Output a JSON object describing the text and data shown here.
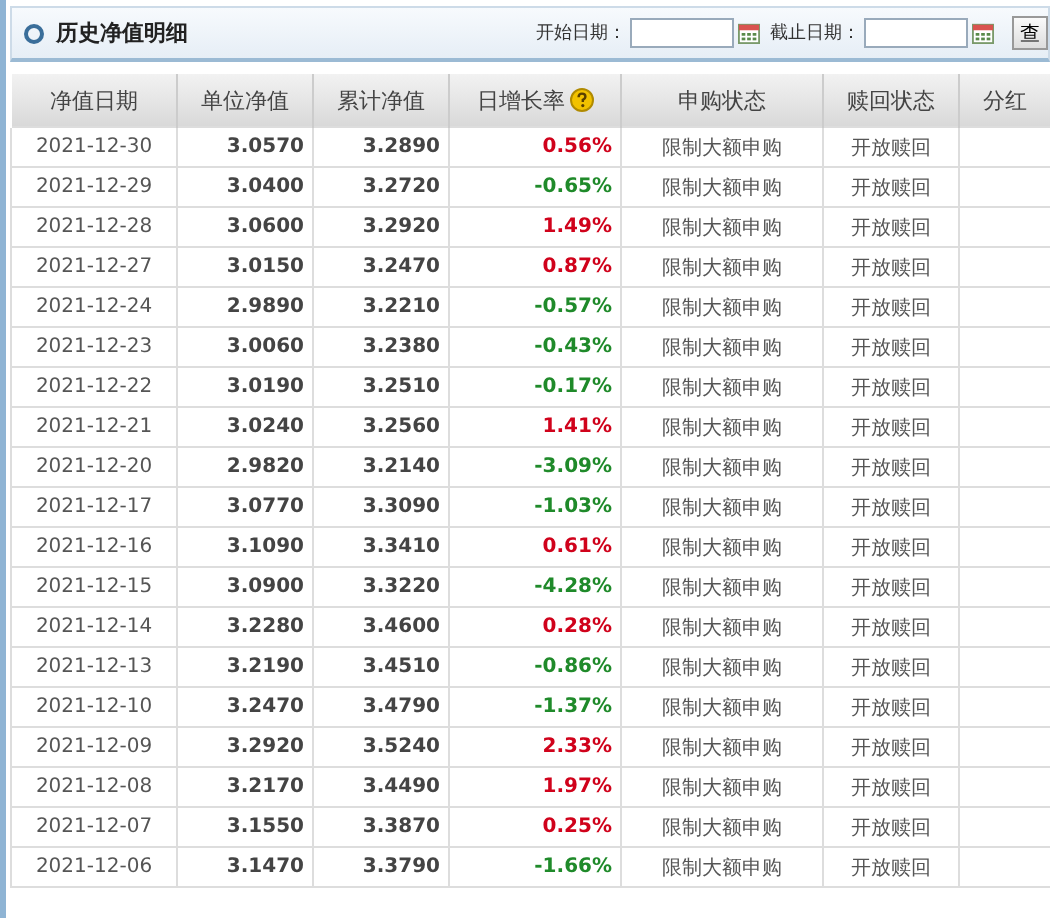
{
  "header": {
    "title": "历史净值明细",
    "start_label": "开始日期：",
    "end_label": "截止日期：",
    "query_button": "查"
  },
  "table": {
    "columns": [
      "净值日期",
      "单位净值",
      "累计净值",
      "日增长率",
      "申购状态",
      "赎回状态",
      "分红"
    ],
    "rows": [
      {
        "date": "2021-12-30",
        "nav": "3.0570",
        "acc": "3.2890",
        "change": "0.56%",
        "color": "#d0021b",
        "buy": "限制大额申购",
        "redeem": "开放赎回"
      },
      {
        "date": "2021-12-29",
        "nav": "3.0400",
        "acc": "3.2720",
        "change": "-0.65%",
        "color": "#1f8a2a",
        "buy": "限制大额申购",
        "redeem": "开放赎回"
      },
      {
        "date": "2021-12-28",
        "nav": "3.0600",
        "acc": "3.2920",
        "change": "1.49%",
        "color": "#d0021b",
        "buy": "限制大额申购",
        "redeem": "开放赎回"
      },
      {
        "date": "2021-12-27",
        "nav": "3.0150",
        "acc": "3.2470",
        "change": "0.87%",
        "color": "#d0021b",
        "buy": "限制大额申购",
        "redeem": "开放赎回"
      },
      {
        "date": "2021-12-24",
        "nav": "2.9890",
        "acc": "3.2210",
        "change": "-0.57%",
        "color": "#1f8a2a",
        "buy": "限制大额申购",
        "redeem": "开放赎回"
      },
      {
        "date": "2021-12-23",
        "nav": "3.0060",
        "acc": "3.2380",
        "change": "-0.43%",
        "color": "#1f8a2a",
        "buy": "限制大额申购",
        "redeem": "开放赎回"
      },
      {
        "date": "2021-12-22",
        "nav": "3.0190",
        "acc": "3.2510",
        "change": "-0.17%",
        "color": "#1f8a2a",
        "buy": "限制大额申购",
        "redeem": "开放赎回"
      },
      {
        "date": "2021-12-21",
        "nav": "3.0240",
        "acc": "3.2560",
        "change": "1.41%",
        "color": "#d0021b",
        "buy": "限制大额申购",
        "redeem": "开放赎回"
      },
      {
        "date": "2021-12-20",
        "nav": "2.9820",
        "acc": "3.2140",
        "change": "-3.09%",
        "color": "#1f8a2a",
        "buy": "限制大额申购",
        "redeem": "开放赎回"
      },
      {
        "date": "2021-12-17",
        "nav": "3.0770",
        "acc": "3.3090",
        "change": "-1.03%",
        "color": "#1f8a2a",
        "buy": "限制大额申购",
        "redeem": "开放赎回"
      },
      {
        "date": "2021-12-16",
        "nav": "3.1090",
        "acc": "3.3410",
        "change": "0.61%",
        "color": "#d0021b",
        "buy": "限制大额申购",
        "redeem": "开放赎回"
      },
      {
        "date": "2021-12-15",
        "nav": "3.0900",
        "acc": "3.3220",
        "change": "-4.28%",
        "color": "#1f8a2a",
        "buy": "限制大额申购",
        "redeem": "开放赎回"
      },
      {
        "date": "2021-12-14",
        "nav": "3.2280",
        "acc": "3.4600",
        "change": "0.28%",
        "color": "#d0021b",
        "buy": "限制大额申购",
        "redeem": "开放赎回"
      },
      {
        "date": "2021-12-13",
        "nav": "3.2190",
        "acc": "3.4510",
        "change": "-0.86%",
        "color": "#1f8a2a",
        "buy": "限制大额申购",
        "redeem": "开放赎回"
      },
      {
        "date": "2021-12-10",
        "nav": "3.2470",
        "acc": "3.4790",
        "change": "-1.37%",
        "color": "#1f8a2a",
        "buy": "限制大额申购",
        "redeem": "开放赎回"
      },
      {
        "date": "2021-12-09",
        "nav": "3.2920",
        "acc": "3.5240",
        "change": "2.33%",
        "color": "#d0021b",
        "buy": "限制大额申购",
        "redeem": "开放赎回"
      },
      {
        "date": "2021-12-08",
        "nav": "3.2170",
        "acc": "3.4490",
        "change": "1.97%",
        "color": "#d0021b",
        "buy": "限制大额申购",
        "redeem": "开放赎回"
      },
      {
        "date": "2021-12-07",
        "nav": "3.1550",
        "acc": "3.3870",
        "change": "0.25%",
        "color": "#d0021b",
        "buy": "限制大额申购",
        "redeem": "开放赎回"
      },
      {
        "date": "2021-12-06",
        "nav": "3.1470",
        "acc": "3.3790",
        "change": "-1.66%",
        "color": "#1f8a2a",
        "buy": "限制大额申购",
        "redeem": "开放赎回"
      }
    ]
  }
}
